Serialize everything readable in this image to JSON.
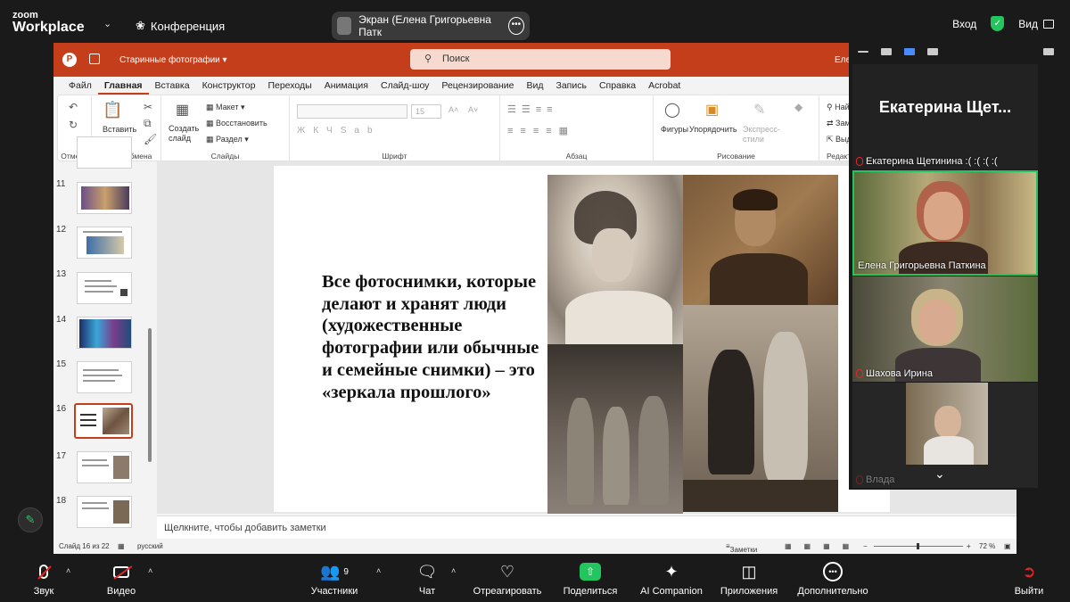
{
  "zoom": {
    "logo_line1": "zoom",
    "logo_line2": "Workplace",
    "conference_label": "Конференция",
    "share_label": "Экран (Елена  Григорьевна Патк",
    "signin": "Вход",
    "view": "Вид",
    "accent": "#23c55e"
  },
  "ppt": {
    "doc_title": "Старинные фотографии",
    "search_placeholder": "Поиск",
    "user_short": "Еле",
    "tabs": [
      "Файл",
      "Главная",
      "Вставка",
      "Конструктор",
      "Переходы",
      "Анимация",
      "Слайд-шоу",
      "Рецензирование",
      "Вид",
      "Запись",
      "Справка",
      "Acrobat"
    ],
    "ribbon": {
      "undo_group": "Отмена",
      "clipboard_group": "Буфер обмена",
      "paste": "Вставить",
      "slides_group": "Слайды",
      "create_slide": "Создать слайд",
      "layout": "Макет",
      "reset": "Восстановить",
      "section": "Раздел",
      "font_group": "Шрифт",
      "font_size": "15",
      "paragraph_group": "Абзац",
      "drawing_group": "Рисование",
      "shapes": "Фигуры",
      "arrange": "Упорядочить",
      "quick_styles": "Экспресс-стили",
      "edit_group": "Редакт",
      "find": "Най",
      "replace": "Зам",
      "select": "Выд"
    },
    "slide_numbers": [
      "11",
      "12",
      "13",
      "14",
      "15",
      "16",
      "17",
      "18"
    ],
    "slide_text": "Все фотоснимки, которые делают и хранят люди (художественные фотографии или обычные и семейные снимки) – это «зеркала прошлого»",
    "notes_placeholder": "Щелкните, чтобы добавить заметки",
    "status": {
      "slide_of": "Слайд 16 из 22",
      "language": "русский",
      "notes": "Заметки",
      "zoom": "72 %"
    },
    "accent": "#c43e1c"
  },
  "participants": {
    "big_name": "Екатерина  Щет...",
    "tiles": [
      {
        "name": "Екатерина Щетинина :( :( :( :(",
        "muted": true
      },
      {
        "name": "Елена  Григорьевна Паткина",
        "muted": false
      },
      {
        "name": "Шахова Ирина",
        "muted": true
      },
      {
        "name": "Влада",
        "muted": true
      }
    ]
  },
  "toolbar": {
    "audio": "Звук",
    "video": "Видео",
    "participants": "Участники",
    "participants_count": "9",
    "chat": "Чат",
    "react": "Отреагировать",
    "share": "Поделиться",
    "ai": "AI Companion",
    "apps": "Приложения",
    "more": "Дополнительно",
    "leave": "Выйти"
  }
}
